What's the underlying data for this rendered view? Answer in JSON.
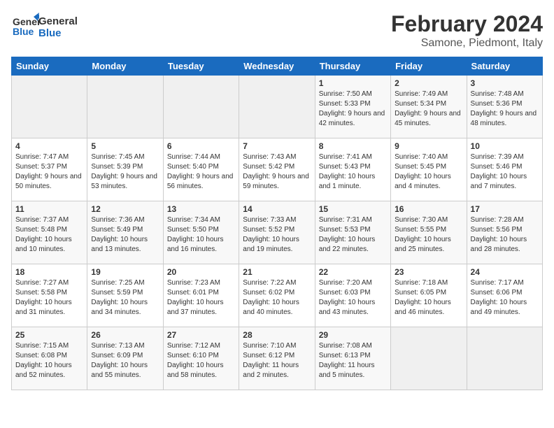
{
  "logo": {
    "line1": "General",
    "line2": "Blue"
  },
  "title": "February 2024",
  "location": "Samone, Piedmont, Italy",
  "days_of_week": [
    "Sunday",
    "Monday",
    "Tuesday",
    "Wednesday",
    "Thursday",
    "Friday",
    "Saturday"
  ],
  "weeks": [
    [
      {
        "day": "",
        "sunrise": "",
        "sunset": "",
        "daylight": ""
      },
      {
        "day": "",
        "sunrise": "",
        "sunset": "",
        "daylight": ""
      },
      {
        "day": "",
        "sunrise": "",
        "sunset": "",
        "daylight": ""
      },
      {
        "day": "",
        "sunrise": "",
        "sunset": "",
        "daylight": ""
      },
      {
        "day": "1",
        "sunrise": "Sunrise: 7:50 AM",
        "sunset": "Sunset: 5:33 PM",
        "daylight": "Daylight: 9 hours and 42 minutes."
      },
      {
        "day": "2",
        "sunrise": "Sunrise: 7:49 AM",
        "sunset": "Sunset: 5:34 PM",
        "daylight": "Daylight: 9 hours and 45 minutes."
      },
      {
        "day": "3",
        "sunrise": "Sunrise: 7:48 AM",
        "sunset": "Sunset: 5:36 PM",
        "daylight": "Daylight: 9 hours and 48 minutes."
      }
    ],
    [
      {
        "day": "4",
        "sunrise": "Sunrise: 7:47 AM",
        "sunset": "Sunset: 5:37 PM",
        "daylight": "Daylight: 9 hours and 50 minutes."
      },
      {
        "day": "5",
        "sunrise": "Sunrise: 7:45 AM",
        "sunset": "Sunset: 5:39 PM",
        "daylight": "Daylight: 9 hours and 53 minutes."
      },
      {
        "day": "6",
        "sunrise": "Sunrise: 7:44 AM",
        "sunset": "Sunset: 5:40 PM",
        "daylight": "Daylight: 9 hours and 56 minutes."
      },
      {
        "day": "7",
        "sunrise": "Sunrise: 7:43 AM",
        "sunset": "Sunset: 5:42 PM",
        "daylight": "Daylight: 9 hours and 59 minutes."
      },
      {
        "day": "8",
        "sunrise": "Sunrise: 7:41 AM",
        "sunset": "Sunset: 5:43 PM",
        "daylight": "Daylight: 10 hours and 1 minute."
      },
      {
        "day": "9",
        "sunrise": "Sunrise: 7:40 AM",
        "sunset": "Sunset: 5:45 PM",
        "daylight": "Daylight: 10 hours and 4 minutes."
      },
      {
        "day": "10",
        "sunrise": "Sunrise: 7:39 AM",
        "sunset": "Sunset: 5:46 PM",
        "daylight": "Daylight: 10 hours and 7 minutes."
      }
    ],
    [
      {
        "day": "11",
        "sunrise": "Sunrise: 7:37 AM",
        "sunset": "Sunset: 5:48 PM",
        "daylight": "Daylight: 10 hours and 10 minutes."
      },
      {
        "day": "12",
        "sunrise": "Sunrise: 7:36 AM",
        "sunset": "Sunset: 5:49 PM",
        "daylight": "Daylight: 10 hours and 13 minutes."
      },
      {
        "day": "13",
        "sunrise": "Sunrise: 7:34 AM",
        "sunset": "Sunset: 5:50 PM",
        "daylight": "Daylight: 10 hours and 16 minutes."
      },
      {
        "day": "14",
        "sunrise": "Sunrise: 7:33 AM",
        "sunset": "Sunset: 5:52 PM",
        "daylight": "Daylight: 10 hours and 19 minutes."
      },
      {
        "day": "15",
        "sunrise": "Sunrise: 7:31 AM",
        "sunset": "Sunset: 5:53 PM",
        "daylight": "Daylight: 10 hours and 22 minutes."
      },
      {
        "day": "16",
        "sunrise": "Sunrise: 7:30 AM",
        "sunset": "Sunset: 5:55 PM",
        "daylight": "Daylight: 10 hours and 25 minutes."
      },
      {
        "day": "17",
        "sunrise": "Sunrise: 7:28 AM",
        "sunset": "Sunset: 5:56 PM",
        "daylight": "Daylight: 10 hours and 28 minutes."
      }
    ],
    [
      {
        "day": "18",
        "sunrise": "Sunrise: 7:27 AM",
        "sunset": "Sunset: 5:58 PM",
        "daylight": "Daylight: 10 hours and 31 minutes."
      },
      {
        "day": "19",
        "sunrise": "Sunrise: 7:25 AM",
        "sunset": "Sunset: 5:59 PM",
        "daylight": "Daylight: 10 hours and 34 minutes."
      },
      {
        "day": "20",
        "sunrise": "Sunrise: 7:23 AM",
        "sunset": "Sunset: 6:01 PM",
        "daylight": "Daylight: 10 hours and 37 minutes."
      },
      {
        "day": "21",
        "sunrise": "Sunrise: 7:22 AM",
        "sunset": "Sunset: 6:02 PM",
        "daylight": "Daylight: 10 hours and 40 minutes."
      },
      {
        "day": "22",
        "sunrise": "Sunrise: 7:20 AM",
        "sunset": "Sunset: 6:03 PM",
        "daylight": "Daylight: 10 hours and 43 minutes."
      },
      {
        "day": "23",
        "sunrise": "Sunrise: 7:18 AM",
        "sunset": "Sunset: 6:05 PM",
        "daylight": "Daylight: 10 hours and 46 minutes."
      },
      {
        "day": "24",
        "sunrise": "Sunrise: 7:17 AM",
        "sunset": "Sunset: 6:06 PM",
        "daylight": "Daylight: 10 hours and 49 minutes."
      }
    ],
    [
      {
        "day": "25",
        "sunrise": "Sunrise: 7:15 AM",
        "sunset": "Sunset: 6:08 PM",
        "daylight": "Daylight: 10 hours and 52 minutes."
      },
      {
        "day": "26",
        "sunrise": "Sunrise: 7:13 AM",
        "sunset": "Sunset: 6:09 PM",
        "daylight": "Daylight: 10 hours and 55 minutes."
      },
      {
        "day": "27",
        "sunrise": "Sunrise: 7:12 AM",
        "sunset": "Sunset: 6:10 PM",
        "daylight": "Daylight: 10 hours and 58 minutes."
      },
      {
        "day": "28",
        "sunrise": "Sunrise: 7:10 AM",
        "sunset": "Sunset: 6:12 PM",
        "daylight": "Daylight: 11 hours and 2 minutes."
      },
      {
        "day": "29",
        "sunrise": "Sunrise: 7:08 AM",
        "sunset": "Sunset: 6:13 PM",
        "daylight": "Daylight: 11 hours and 5 minutes."
      },
      {
        "day": "",
        "sunrise": "",
        "sunset": "",
        "daylight": ""
      },
      {
        "day": "",
        "sunrise": "",
        "sunset": "",
        "daylight": ""
      }
    ]
  ]
}
